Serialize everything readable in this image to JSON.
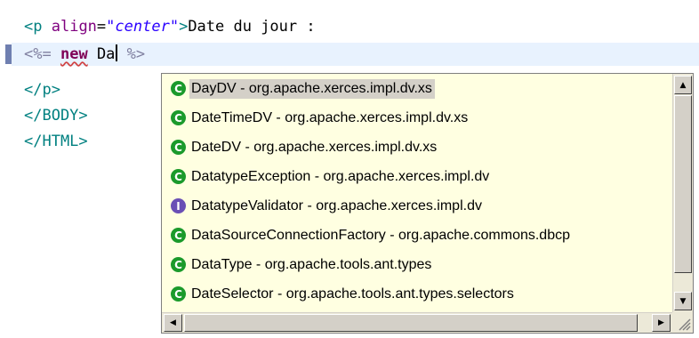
{
  "editor": {
    "line1": {
      "tag_open": "<p",
      "attr_name": "align",
      "equals": "=",
      "attr_value": "\"center\"",
      "tag_close": ">",
      "text": "Date du jour :"
    },
    "line2": {
      "jsp_open": "<%=",
      "keyword": "new",
      "typed": "Da",
      "jsp_close": "%>"
    },
    "line3": "</p>",
    "line4": "</BODY>",
    "line5": "</HTML>"
  },
  "autocomplete": {
    "items": [
      {
        "icon": "class-icon",
        "label": "DayDV - org.apache.xerces.impl.dv.xs",
        "selected": true
      },
      {
        "icon": "class-icon",
        "label": "DateTimeDV - org.apache.xerces.impl.dv.xs"
      },
      {
        "icon": "class-icon",
        "label": "DateDV - org.apache.xerces.impl.dv.xs"
      },
      {
        "icon": "class-icon",
        "label": "DatatypeException - org.apache.xerces.impl.dv"
      },
      {
        "icon": "interface-icon",
        "label": "DatatypeValidator - org.apache.xerces.impl.dv"
      },
      {
        "icon": "class-icon",
        "label": "DataSourceConnectionFactory - org.apache.commons.dbcp"
      },
      {
        "icon": "class-icon",
        "label": "DataType - org.apache.tools.ant.types"
      },
      {
        "icon": "class-icon",
        "label": "DateSelector - org.apache.tools.ant.types.selectors"
      }
    ],
    "class_glyph": "C",
    "interface_glyph": "I"
  },
  "colors": {
    "class_icon": "#1b9a2b",
    "interface_icon": "#6a4fb5",
    "popup_bg": "#ffffe1"
  }
}
